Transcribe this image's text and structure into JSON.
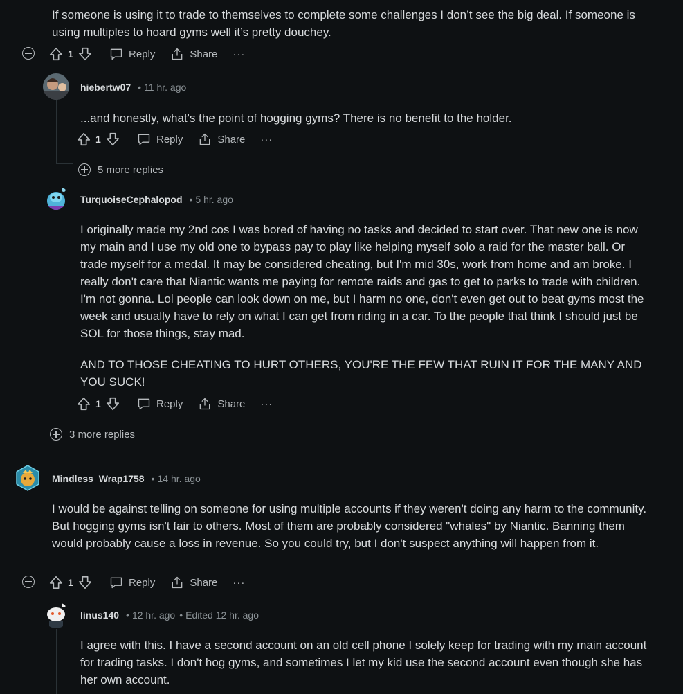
{
  "action_labels": {
    "reply": "Reply",
    "share": "Share",
    "more": "···"
  },
  "comments": [
    {
      "body": "If someone is using it to trade to themselves to complete some challenges I don’t see the big deal. If someone is using multiples to hoard gyms well it’s pretty douchey.",
      "score": "1"
    },
    {
      "username": "hiebertw07",
      "time": "11 hr. ago",
      "body": "...and honestly, what's the point of hogging gyms? There is no benefit to the holder.",
      "score": "1",
      "more_replies": "5 more replies"
    },
    {
      "username": "TurquoiseCephalopod",
      "time": "5 hr. ago",
      "body_p1": "I originally made my 2nd cos I was bored of having no tasks and decided to start over. That new one is now my main and I use my old one to bypass pay to play like helping myself solo a raid for the master ball. Or trade myself for a medal. It may be considered cheating, but I'm mid 30s, work from home and am broke. I really don't care that Niantic wants me paying for remote raids and gas to get to parks to trade with children. I'm not gonna. Lol people can look down on me, but I harm no one, don't even get out to beat gyms most the week and usually have to rely on what I can get from riding in a car. To the people that think I should just be SOL for those things, stay mad.",
      "body_p2": "AND TO THOSE CHEATING TO HURT OTHERS, YOU'RE THE FEW THAT RUIN IT FOR THE MANY AND YOU SUCK!",
      "score": "1",
      "more_replies": "3 more replies"
    },
    {
      "username": "Mindless_Wrap1758",
      "time": "14 hr. ago",
      "body": "I would be against telling on someone for using multiple accounts if they weren't doing any harm to the community. But hogging gyms isn't fair to others. Most of them are probably considered \"whales\" by Niantic. Banning them would probably cause a loss in revenue. So you could try, but I don't suspect anything will happen from it.",
      "score": "1"
    },
    {
      "username": "linus140",
      "time": "12 hr. ago",
      "edited": "Edited 12 hr. ago",
      "body": "I agree with this. I have a second account on an old cell phone I solely keep for trading with my main account for trading tasks. I don't hog gyms, and sometimes I let my kid use the second account even though she has her own account."
    }
  ]
}
